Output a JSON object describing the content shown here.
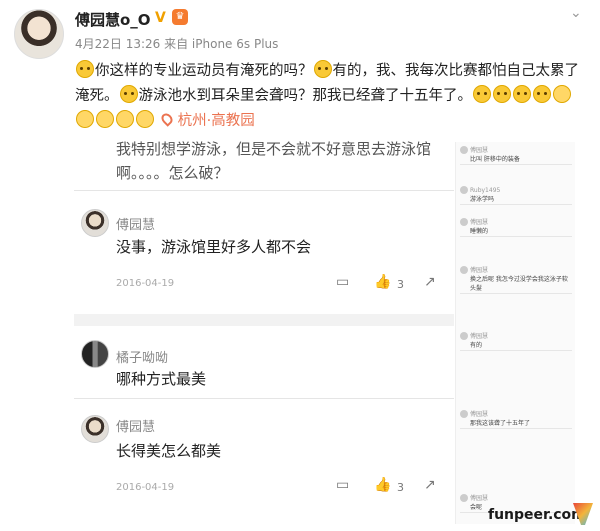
{
  "post": {
    "username": "傅园慧o_O",
    "verified_badge": "V",
    "meta": "4月22日 13:26 来自 iPhone 6s Plus",
    "text_segments": [
      "你这样的专业运动员有淹死的吗？",
      "有的，我、我每次比赛都怕自己太累了淹死。",
      "游泳池水到耳朵里会聋吗？那我已经聋了十五年了。"
    ],
    "location": "杭州·高教园"
  },
  "screenshot": {
    "question": "我特别想学游泳，但是不会就不好意思去游泳馆啊。。。。怎么破？",
    "comments": [
      {
        "name": "傅园慧",
        "text": "没事，游泳馆里好多人都不会",
        "date": "2016-04-19",
        "likes": "3"
      },
      {
        "name": "橘子呦呦",
        "text": "哪种方式最美"
      },
      {
        "name": "傅园慧",
        "text": "长得美怎么都美",
        "date": "2016-04-19",
        "likes": "3"
      }
    ]
  },
  "thumbs": [
    {
      "name": "傅园慧",
      "text": "比叫 肝移中的装备"
    },
    {
      "name": "Ruby1495",
      "text": "游泳学吗"
    },
    {
      "name": "傅园慧",
      "text": "睡懒的"
    },
    {
      "name": "傅园慧",
      "text": "换之后呢 我怎今过没学会我这泳子软头髮"
    },
    {
      "name": "傅园慧",
      "text": "有的"
    },
    {
      "name": "傅园慧",
      "text": "那我这该聋了十五年了"
    },
    {
      "name": "傅园慧",
      "text": "会呢"
    }
  ],
  "watermark": "funpeer.com"
}
